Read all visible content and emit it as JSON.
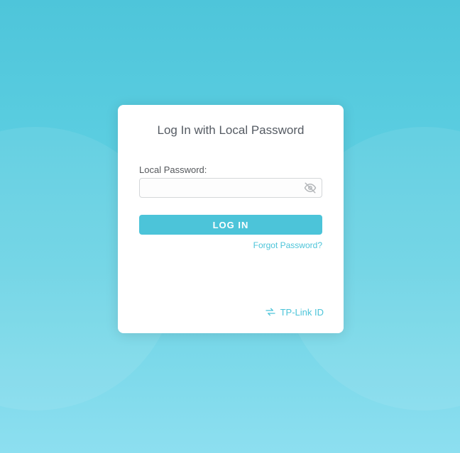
{
  "login": {
    "title": "Log In with Local Password",
    "password_label": "Local Password:",
    "password_value": "",
    "submit_label": "LOG IN",
    "forgot_label": "Forgot Password?",
    "tpid_label": "TP-Link ID"
  },
  "colors": {
    "accent": "#4cc4d9",
    "text": "#55585c"
  }
}
